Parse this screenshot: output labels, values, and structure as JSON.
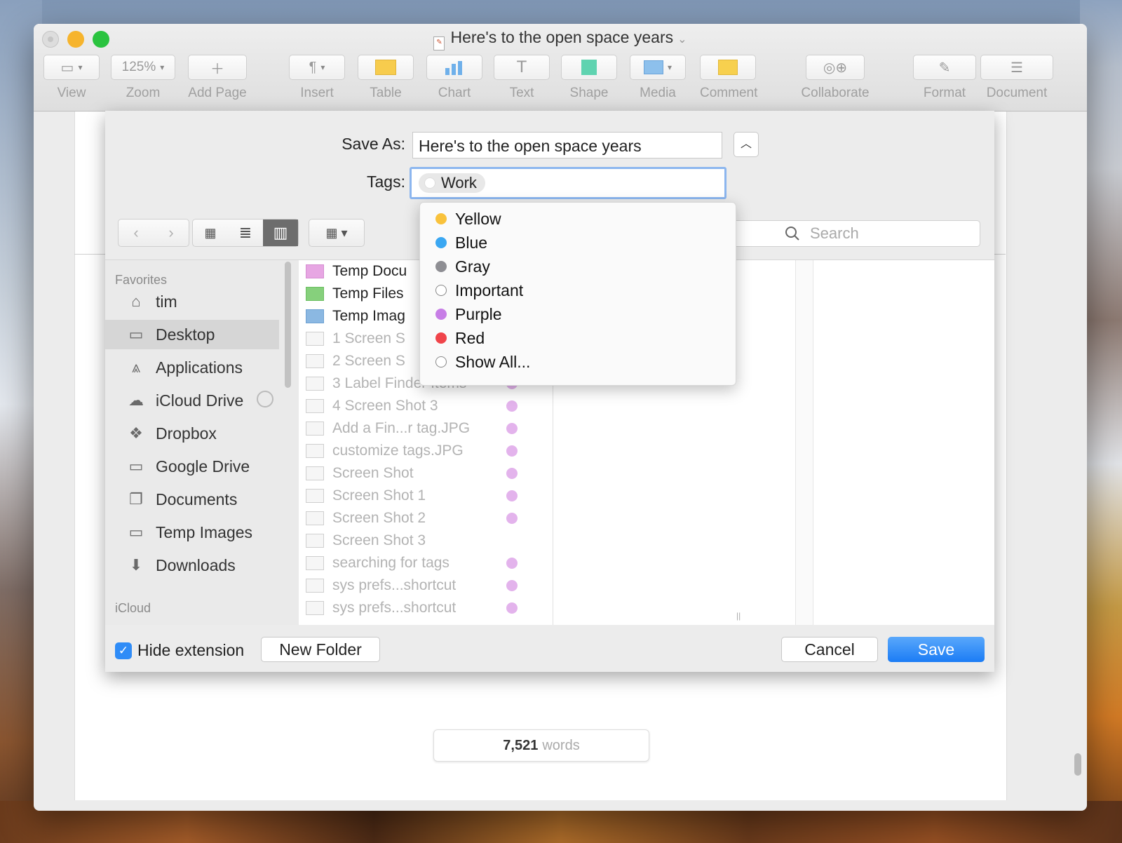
{
  "window": {
    "title": "Here's to the open space years"
  },
  "toolbar": {
    "items": [
      {
        "label": "View",
        "icon": "sidebar-view-icon"
      },
      {
        "label": "Zoom",
        "value": "125%"
      },
      {
        "label": "Add Page",
        "icon": "plus-icon"
      },
      {
        "label": "Insert",
        "icon": "pilcrow-icon"
      },
      {
        "label": "Table",
        "icon": "table-icon"
      },
      {
        "label": "Chart",
        "icon": "chart-icon"
      },
      {
        "label": "Text",
        "icon": "text-icon"
      },
      {
        "label": "Shape",
        "icon": "shape-icon"
      },
      {
        "label": "Media",
        "icon": "media-icon"
      },
      {
        "label": "Comment",
        "icon": "comment-icon"
      },
      {
        "label": "Collaborate",
        "icon": "collaborate-icon"
      },
      {
        "label": "Format",
        "icon": "paintbrush-icon"
      },
      {
        "label": "Document",
        "icon": "document-icon"
      }
    ]
  },
  "save_dialog": {
    "save_as_label": "Save As:",
    "save_as_value": "Here's to the open space years",
    "tags_label": "Tags:",
    "tag_token": "Work",
    "search_placeholder": "Search",
    "sidebar": {
      "favorites_heading": "Favorites",
      "icloud_heading": "iCloud",
      "items": [
        {
          "label": "tim",
          "icon": "home-icon"
        },
        {
          "label": "Desktop",
          "icon": "desktop-icon",
          "selected": true
        },
        {
          "label": "Applications",
          "icon": "applications-icon"
        },
        {
          "label": "iCloud Drive",
          "icon": "cloud-icon"
        },
        {
          "label": "Dropbox",
          "icon": "dropbox-icon"
        },
        {
          "label": "Google Drive",
          "icon": "folder-icon"
        },
        {
          "label": "Documents",
          "icon": "documents-icon"
        },
        {
          "label": "Temp Images",
          "icon": "folder-icon"
        },
        {
          "label": "Downloads",
          "icon": "download-icon"
        }
      ]
    },
    "files": [
      {
        "name": "Temp Docu",
        "kind": "folder-pink",
        "enabled": true,
        "tag": false
      },
      {
        "name": "Temp Files",
        "kind": "folder-green",
        "enabled": true,
        "tag": false
      },
      {
        "name": "Temp Imag",
        "kind": "folder-blue",
        "enabled": true,
        "tag": false
      },
      {
        "name": "1 Screen S",
        "kind": "image",
        "enabled": false,
        "tag": false
      },
      {
        "name": "2 Screen S",
        "kind": "image",
        "enabled": false,
        "tag": false
      },
      {
        "name": "3 Label Finder Items",
        "kind": "image",
        "enabled": false,
        "tag": true
      },
      {
        "name": "4 Screen Shot 3",
        "kind": "image",
        "enabled": false,
        "tag": true
      },
      {
        "name": "Add a Fin...r tag.JPG",
        "kind": "image",
        "enabled": false,
        "tag": true
      },
      {
        "name": "customize tags.JPG",
        "kind": "image",
        "enabled": false,
        "tag": true
      },
      {
        "name": "Screen Shot",
        "kind": "image",
        "enabled": false,
        "tag": true
      },
      {
        "name": "Screen Shot 1",
        "kind": "image",
        "enabled": false,
        "tag": true
      },
      {
        "name": "Screen Shot 2",
        "kind": "image",
        "enabled": false,
        "tag": true
      },
      {
        "name": "Screen Shot 3",
        "kind": "image",
        "enabled": false,
        "tag": false
      },
      {
        "name": "searching for tags",
        "kind": "image",
        "enabled": false,
        "tag": true
      },
      {
        "name": "sys prefs...shortcut",
        "kind": "image",
        "enabled": false,
        "tag": true
      },
      {
        "name": "sys prefs...shortcut",
        "kind": "image",
        "enabled": false,
        "tag": true
      }
    ],
    "hide_extension_label": "Hide extension",
    "hide_extension_checked": true,
    "new_folder_label": "New Folder",
    "cancel_label": "Cancel",
    "save_label": "Save"
  },
  "tags_menu": {
    "items": [
      {
        "label": "Yellow",
        "color": "#f9c23c"
      },
      {
        "label": "Blue",
        "color": "#3aa7f2"
      },
      {
        "label": "Gray",
        "color": "#8e8e93"
      },
      {
        "label": "Important",
        "color": "none"
      },
      {
        "label": "Purple",
        "color": "#c77ee6"
      },
      {
        "label": "Red",
        "color": "#f0444a"
      },
      {
        "label": "Show All...",
        "color": "none"
      }
    ]
  },
  "status": {
    "word_count": "7,521",
    "word_label": "words"
  },
  "colors": {
    "accent": "#1b7cf5",
    "tag_purple": "#e3b3ec"
  }
}
